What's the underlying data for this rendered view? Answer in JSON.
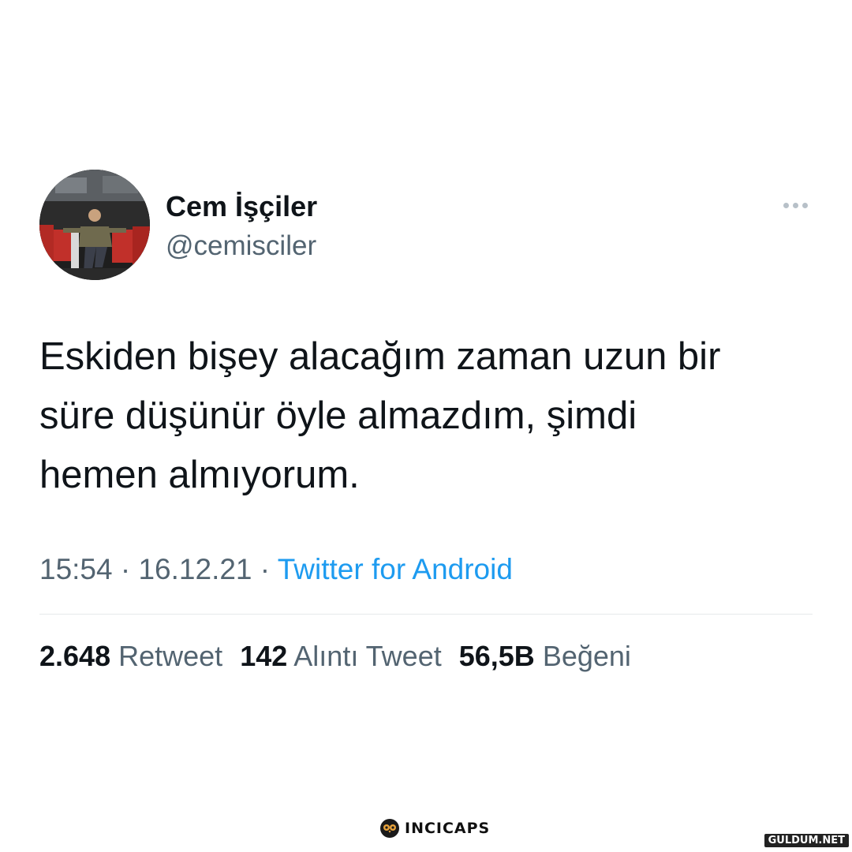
{
  "author": {
    "display_name": "Cem İşçiler",
    "handle": "@cemisciler"
  },
  "tweet": {
    "text": "Eskiden bişey alacağım zaman uzun bir\nsüre düşünür öyle almazdım, şimdi\nhemen almıyorum.",
    "time": "15:54",
    "separator": " · ",
    "date": "16.12.21",
    "source": "Twitter for Android"
  },
  "stats": {
    "retweets_count": "2.648",
    "retweets_label": "Retweet",
    "quotes_count": "142",
    "quotes_label": "Alıntı Tweet",
    "likes_count": "56,5B",
    "likes_label": "Beğeni"
  },
  "footer": {
    "logo_text": "INCICAPS",
    "watermark_text": "GULDUM.NET"
  },
  "icons": {
    "more": "more-horizontal-icon",
    "logo": "owl-logo-icon"
  },
  "colors": {
    "text_primary": "#0f1419",
    "text_secondary": "#536471",
    "link": "#1d9bf0",
    "divider": "#e6e9eb"
  }
}
